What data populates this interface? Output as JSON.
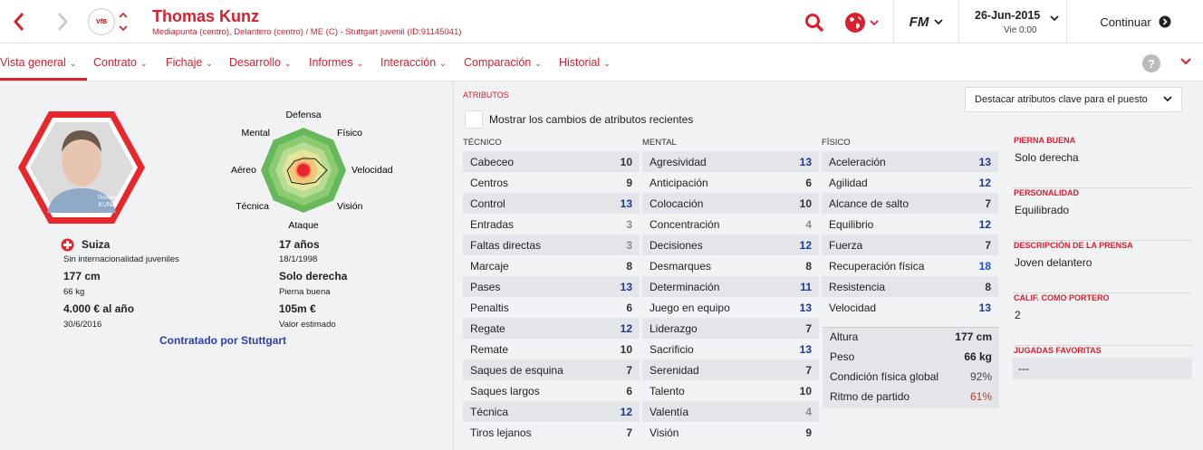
{
  "header": {
    "name": "Thomas Kunz",
    "subtitle": "Mediapunta (centro), Delantero (centro) / ME (C) - Stuttgart juvenil (ID:91145041)",
    "date": "26-Jun-2015",
    "day": "Vie 0:00",
    "continue_label": "Continuar",
    "fm_logo": "FM",
    "crest_text": "VfB"
  },
  "tabs": [
    {
      "label": "Vista general"
    },
    {
      "label": "Contrato"
    },
    {
      "label": "Fichaje"
    },
    {
      "label": "Desarrollo"
    },
    {
      "label": "Informes"
    },
    {
      "label": "Interacción"
    },
    {
      "label": "Comparación"
    },
    {
      "label": "Historial"
    }
  ],
  "help_label": "?",
  "player": {
    "portrait_first": "Thomas",
    "portrait_last": "KUNZ",
    "nationality": "Suiza",
    "intl": "Sin internacionalidad juveniles",
    "height": "177 cm",
    "weight": "66 kg",
    "wage": "4.000 € al año",
    "contract_end": "30/6/2016",
    "age": "17 años",
    "dob": "18/1/1998",
    "foot": "Solo derecha",
    "foot_lbl": "Pierna buena",
    "value": "105m €",
    "value_lbl": "Valor estimado",
    "contracted_by": "Contratado por Stuttgart"
  },
  "radar": {
    "labels": {
      "top": "Defensa",
      "tr": "Físico",
      "r": "Velocidad",
      "br": "Visión",
      "bottom": "Ataque",
      "bl": "Técnica",
      "l": "Aéreo",
      "tl": "Mental"
    },
    "values": {
      "top": 0.28,
      "tr": 0.38,
      "r": 0.55,
      "br": 0.4,
      "bottom": 0.33,
      "bl": 0.4,
      "l": 0.38,
      "tl": 0.3
    }
  },
  "attributes": {
    "section_title": "ATRIBUTOS",
    "highlight_label": "Destacar atributos clave para el puesto",
    "show_changes_label": "Mostrar los cambios de atributos recientes",
    "columns": [
      {
        "title": "TÉCNICO",
        "rows": [
          [
            "Cabeceo",
            "10"
          ],
          [
            "Centros",
            "9"
          ],
          [
            "Control",
            "13"
          ],
          [
            "Entradas",
            "3"
          ],
          [
            "Faltas directas",
            "3"
          ],
          [
            "Marcaje",
            "8"
          ],
          [
            "Pases",
            "13"
          ],
          [
            "Penaltis",
            "6"
          ],
          [
            "Regate",
            "12"
          ],
          [
            "Remate",
            "10"
          ],
          [
            "Saques de esquina",
            "7"
          ],
          [
            "Saques largos",
            "6"
          ],
          [
            "Técnica",
            "12"
          ],
          [
            "Tiros lejanos",
            "7"
          ]
        ]
      },
      {
        "title": "MENTAL",
        "rows": [
          [
            "Agresividad",
            "13"
          ],
          [
            "Anticipación",
            "6"
          ],
          [
            "Colocación",
            "10"
          ],
          [
            "Concentración",
            "4"
          ],
          [
            "Decisiones",
            "12"
          ],
          [
            "Desmarques",
            "8"
          ],
          [
            "Determinación",
            "11"
          ],
          [
            "Juego en equipo",
            "13"
          ],
          [
            "Liderazgo",
            "7"
          ],
          [
            "Sacrificio",
            "13"
          ],
          [
            "Serenidad",
            "7"
          ],
          [
            "Talento",
            "10"
          ],
          [
            "Valentía",
            "4"
          ],
          [
            "Visión",
            "9"
          ]
        ]
      },
      {
        "title": "FÍSICO",
        "rows": [
          [
            "Aceleración",
            "13"
          ],
          [
            "Agilidad",
            "12"
          ],
          [
            "Alcance de salto",
            "7"
          ],
          [
            "Equilibrio",
            "12"
          ],
          [
            "Fuerza",
            "7"
          ],
          [
            "Recuperación física",
            "18"
          ],
          [
            "Resistencia",
            "8"
          ],
          [
            "Velocidad",
            "13"
          ]
        ]
      }
    ],
    "physical_extra": [
      [
        "Altura",
        "177 cm"
      ],
      [
        "Peso",
        "66 kg"
      ],
      [
        "Condición física global",
        "92%"
      ],
      [
        "Ritmo de partido",
        "61%"
      ]
    ]
  },
  "side": [
    {
      "title": "PIERNA BUENA",
      "value": "Solo derecha"
    },
    {
      "title": "PERSONALIDAD",
      "value": "Equilibrado"
    },
    {
      "title": "DESCRIPCIÓN DE LA PRENSA",
      "value": "Joven delantero"
    },
    {
      "title": "CALIF. COMO PORTERO",
      "value": "2"
    },
    {
      "title": "JUGADAS FAVORITAS",
      "value": "---"
    }
  ],
  "colors": {
    "accent": "#d8202e",
    "value_blue": "#1f3a8a",
    "value_bright_blue": "#1a4fd6",
    "value_gray": "#8a8a8a",
    "value_dark": "#333333",
    "pct_red": "#c0392b"
  }
}
